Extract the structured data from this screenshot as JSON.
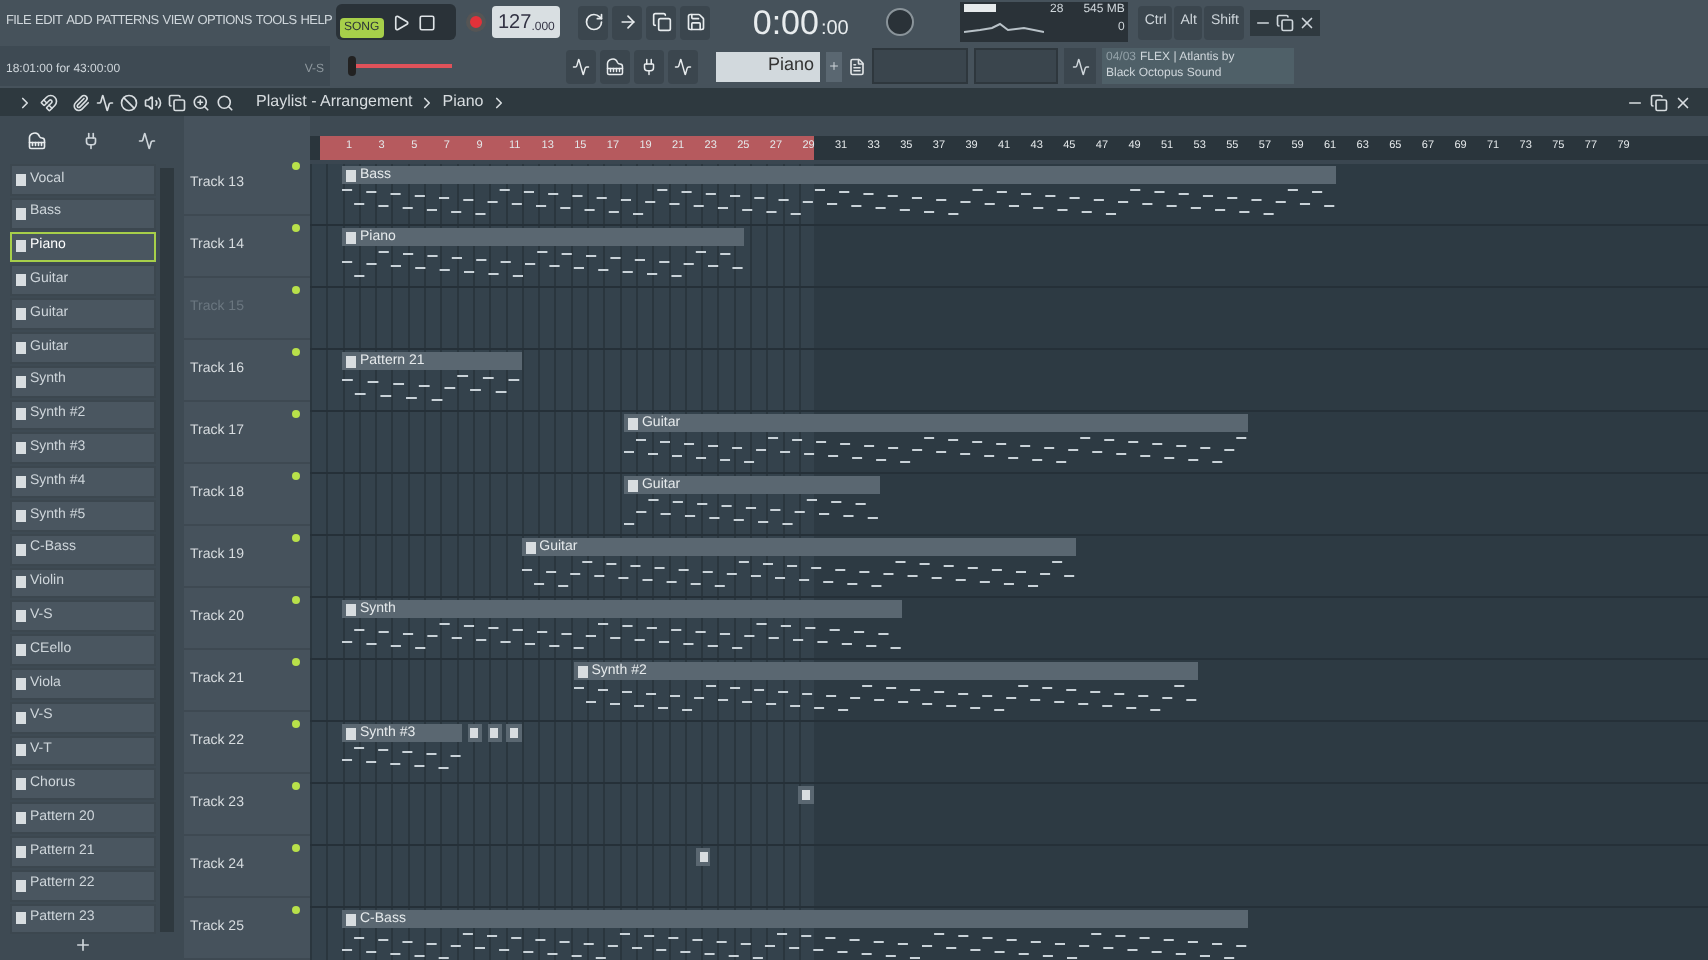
{
  "menu": [
    "FILE",
    "EDIT",
    "ADD",
    "PATTERNS",
    "VIEW",
    "OPTIONS",
    "TOOLS",
    "HELP"
  ],
  "transport": {
    "song_mode": {
      "label": "SONG",
      "selected": true
    },
    "tempo": "127",
    "tempo_fraction": ".000",
    "time": "0:00",
    "time_fraction": ":00"
  },
  "monitor": {
    "cpu": "28",
    "memory": "545 MB",
    "polyphony": "0"
  },
  "modifiers": [
    "Ctrl",
    "Alt",
    "Shift"
  ],
  "hint_bar": {
    "text": "18:01:00 for 43:00:00",
    "plugin": "V-S"
  },
  "pattern_selector": {
    "value": "Piano"
  },
  "news": {
    "date": "04/03",
    "text": "FLEX | Atlantis by",
    "text_2": "Black Octopus Sound"
  },
  "playlist": {
    "title": "Playlist - Arrangement",
    "pattern": "Piano"
  },
  "channels": [
    {
      "name": "Vocal",
      "selected": false
    },
    {
      "name": "Bass",
      "selected": false
    },
    {
      "name": "Piano",
      "selected": true
    },
    {
      "name": "Guitar",
      "selected": false
    },
    {
      "name": "Guitar",
      "selected": false
    },
    {
      "name": "Guitar",
      "selected": false
    },
    {
      "name": "Synth",
      "selected": false
    },
    {
      "name": "Synth #2",
      "selected": false
    },
    {
      "name": "Synth #3",
      "selected": false
    },
    {
      "name": "Synth #4",
      "selected": false
    },
    {
      "name": "Synth #5",
      "selected": false
    },
    {
      "name": "C-Bass",
      "selected": false
    },
    {
      "name": "Violin",
      "selected": false
    },
    {
      "name": "V-S",
      "selected": false
    },
    {
      "name": "CEello",
      "selected": false
    },
    {
      "name": "Viola",
      "selected": false
    },
    {
      "name": "V-S",
      "selected": false
    },
    {
      "name": "V-T",
      "selected": false
    },
    {
      "name": "Chorus",
      "selected": false
    },
    {
      "name": "Pattern 20",
      "selected": false
    },
    {
      "name": "Pattern 21",
      "selected": false
    },
    {
      "name": "Pattern 22",
      "selected": false
    },
    {
      "name": "Pattern 23",
      "selected": false
    }
  ],
  "ruler": [
    "1",
    "3",
    "5",
    "7",
    "9",
    "11",
    "13",
    "15",
    "17",
    "19",
    "21",
    "23",
    "25",
    "27",
    "29",
    "31",
    "33",
    "35",
    "37",
    "39",
    "41",
    "43",
    "45",
    "47",
    "49",
    "51",
    "53",
    "55",
    "57",
    "59",
    "61",
    "63",
    "65",
    "67",
    "69",
    "71",
    "73",
    "75",
    "77",
    "79"
  ],
  "tracks": [
    {
      "name": "Track 13",
      "disabled": false,
      "clips": [
        {
          "kind": "named",
          "name": "Bass"
        }
      ]
    },
    {
      "name": "Track 14",
      "disabled": false,
      "clips": [
        {
          "kind": "named",
          "name": "Piano"
        }
      ]
    },
    {
      "name": "Track 15",
      "disabled": true
    },
    {
      "name": "Track 16",
      "disabled": false,
      "clips": [
        {
          "kind": "named",
          "name": "Pattern 21"
        }
      ]
    },
    {
      "name": "Track 17",
      "disabled": false,
      "clips": [
        {
          "kind": "named",
          "name": "Guitar"
        }
      ]
    },
    {
      "name": "Track 18",
      "disabled": false,
      "clips": [
        {
          "kind": "named",
          "name": "Guitar"
        }
      ]
    },
    {
      "name": "Track 19",
      "disabled": false,
      "clips": [
        {
          "kind": "named",
          "name": "Guitar"
        }
      ]
    },
    {
      "name": "Track 20",
      "disabled": false,
      "clips": [
        {
          "kind": "named",
          "name": "Synth"
        }
      ]
    },
    {
      "name": "Track 21",
      "disabled": false,
      "clips": [
        {
          "kind": "named",
          "name": "Synth #2"
        }
      ]
    },
    {
      "name": "Track 22",
      "disabled": false,
      "clips": [
        {
          "kind": "named",
          "name": "Synth #3"
        },
        {
          "kind": "mini"
        },
        {
          "kind": "mini"
        },
        {
          "kind": "mini"
        }
      ]
    },
    {
      "name": "Track 23",
      "disabled": false,
      "clips": [
        {
          "kind": "mini"
        }
      ]
    },
    {
      "name": "Track 24",
      "disabled": false,
      "clips": [
        {
          "kind": "mini"
        }
      ]
    },
    {
      "name": "Track 25",
      "disabled": false,
      "clips": [
        {
          "kind": "named",
          "name": "C-Bass"
        }
      ]
    }
  ]
}
